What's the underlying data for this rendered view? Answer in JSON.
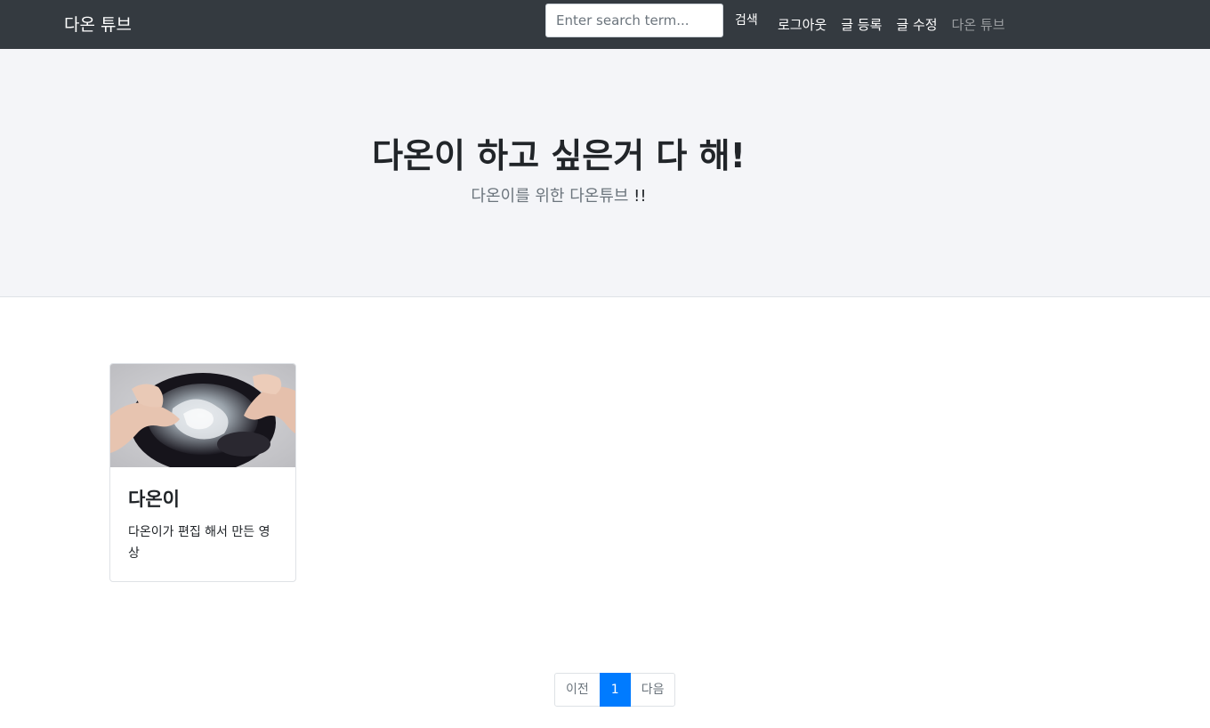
{
  "navbar": {
    "brand": "다온 튜브",
    "search_placeholder": "Enter search term...",
    "search_value": "",
    "search_button": "검색",
    "links": [
      {
        "label": "로그아웃",
        "muted": false
      },
      {
        "label": "글 등록",
        "muted": false
      },
      {
        "label": "글 수정",
        "muted": false
      },
      {
        "label": "다온 튜브",
        "muted": true
      }
    ]
  },
  "hero": {
    "title": "다온이 하고 싶은거 다 해!",
    "subtitle": "다온이를 위한 다온튜브",
    "subtitle_emphasis": "!!"
  },
  "cards": [
    {
      "title": "다온이",
      "text": "다온이가 편집 해서 만든 영상",
      "thumbnail_icon": "video-thumbnail"
    }
  ],
  "pagination": {
    "prev": "이전",
    "current": "1",
    "next": "다음"
  },
  "colors": {
    "navbar_bg": "#343a40",
    "jumbotron_bg": "#f4f5f8",
    "accent": "#007bff"
  }
}
